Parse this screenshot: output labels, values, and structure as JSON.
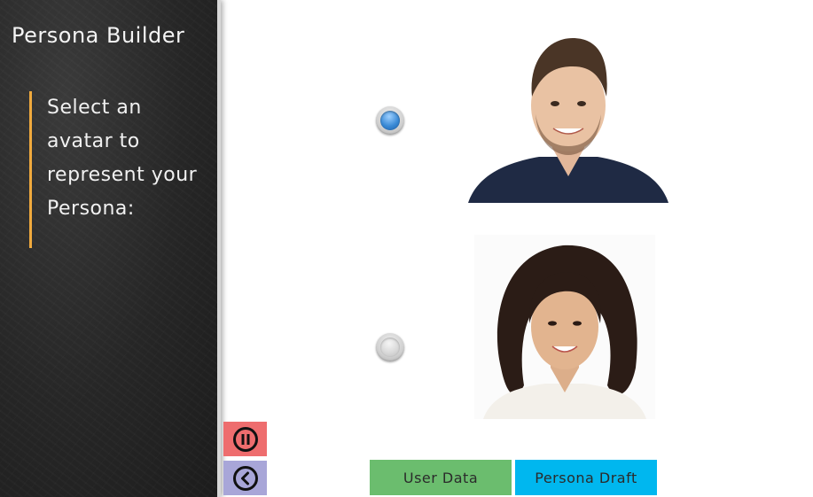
{
  "sidebar": {
    "title": "Persona Builder",
    "instruction": "Select an avatar to represent your Persona:"
  },
  "controls": {
    "pause_icon": "pause-icon",
    "back_icon": "back-icon",
    "pause_color": "#ee6d6e",
    "back_color": "#a8a6d8"
  },
  "avatars": [
    {
      "option": "man-smiling-portrait",
      "selected": true
    },
    {
      "option": "woman-smiling-portrait",
      "selected": false
    }
  ],
  "buttons": {
    "user_data": "User Data",
    "persona_draft": "Persona Draft",
    "user_data_color": "#6bbd6e",
    "persona_draft_color": "#00b7ef"
  },
  "accent": "#f0a93c"
}
